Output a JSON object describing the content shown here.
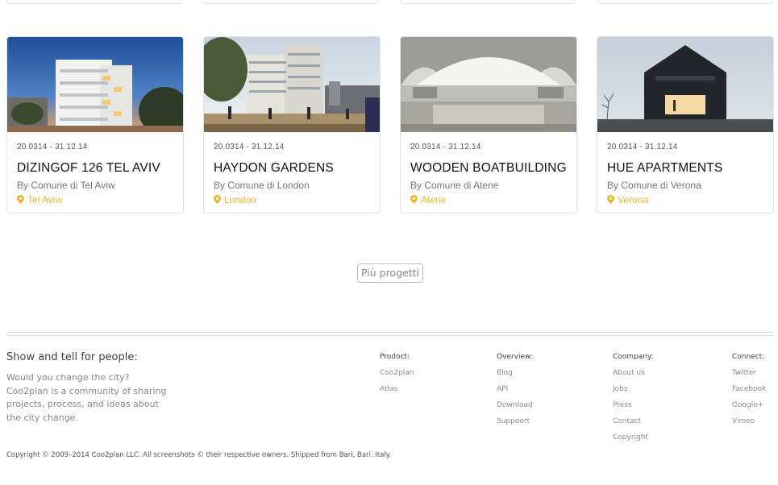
{
  "cards": [
    {
      "date": "20.0314 - 31.12.14",
      "title": "DIZINGOF 126 TEL AVIV",
      "by": "By Comune di Tel Aviw",
      "location": "Tel Aviw",
      "image": "white apartment building at dusk"
    },
    {
      "date": "20.0314 - 31.12.14",
      "title": "HAYDON GARDENS",
      "by": "By Comune di London",
      "location": "London",
      "image": "modern housing block with plaza"
    },
    {
      "date": "20.0314 - 31.12.14",
      "title": "WOODEN BOATBUILDING",
      "by": "By Comune di Atene",
      "location": "Atene",
      "image": "vaulted interior with water"
    },
    {
      "date": "20.0314 - 31.12.14",
      "title": "HUE APARTMENTS",
      "by": "By Comune di Verona",
      "location": "Verona",
      "image": "dark gabled house"
    }
  ],
  "more_button": "Più progetti",
  "footer": {
    "heading": "Show and tell for people:",
    "description": "Would you change the city? Coo2plan is a community of sharing projects, process, and ideas about the city change.",
    "columns": [
      {
        "title": "Prodoct:",
        "links": [
          "Coo2plan",
          "Atlas"
        ]
      },
      {
        "title": "Overview:",
        "links": [
          "Blog",
          "API",
          "Download",
          "Suppoort"
        ]
      },
      {
        "title": "Coompany:",
        "links": [
          "About us",
          "Jobs",
          "Press",
          "Contact",
          "Copyright"
        ]
      },
      {
        "title": "Connect:",
        "links": [
          "Twitter",
          "Facebook",
          "Google+",
          "Vimeo"
        ]
      }
    ],
    "copyright": "Copyright © 2009–2014 Coo2plan LLC. All screenshots © their respective owners. Shipped from Bari, Bari. Italy."
  },
  "colors": {
    "accent": "#f0b429",
    "border": "#e1e1e1",
    "muted_text": "#888888"
  }
}
